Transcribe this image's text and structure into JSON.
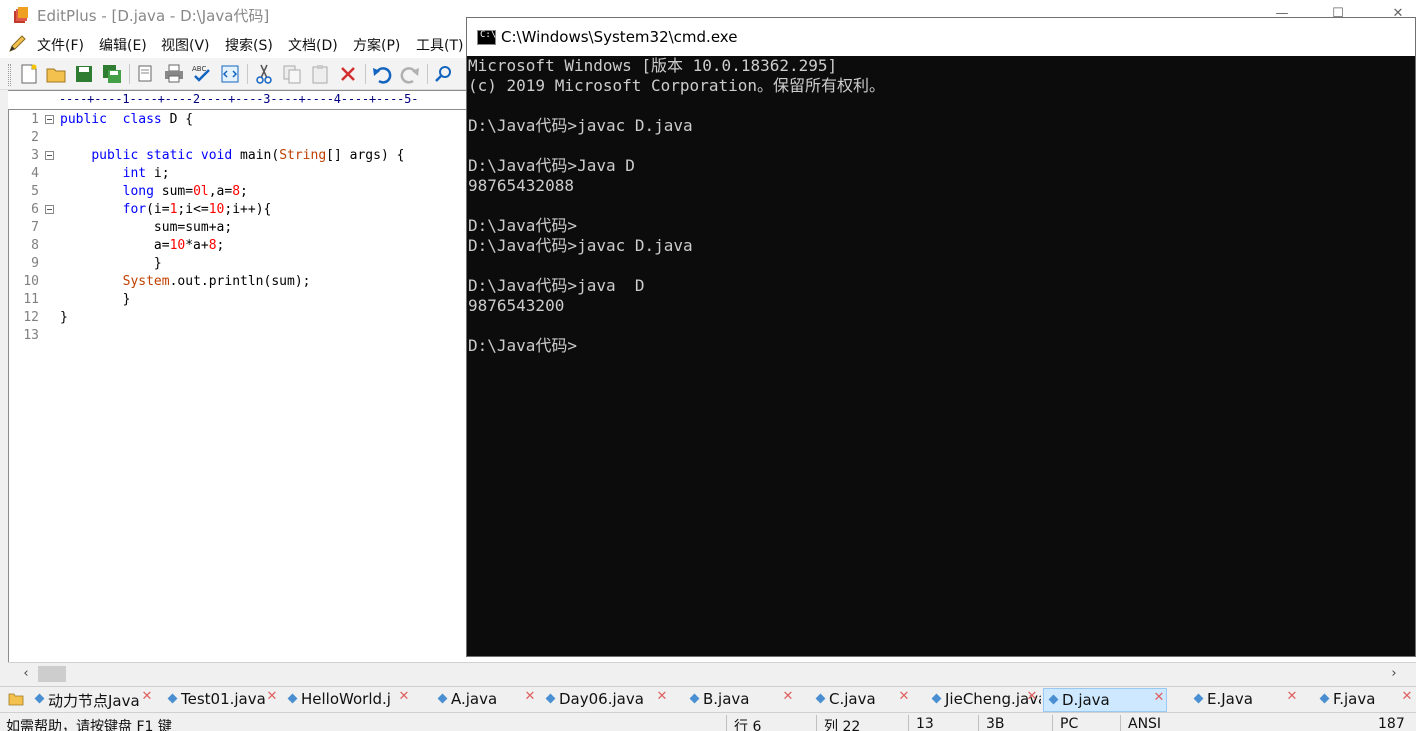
{
  "editplus": {
    "title": "EditPlus - [D.java - D:\\Java代码]",
    "window_controls": [
      "—",
      "☐",
      "✕"
    ],
    "menu": [
      "文件(F)",
      "编辑(E)",
      "视图(V)",
      "搜索(S)",
      "文档(D)",
      "方案(P)",
      "工具(T)"
    ],
    "toolbar": [
      "new-file",
      "open-file",
      "save",
      "save-all",
      "print-preview",
      "print",
      "spell-check",
      "html-preview",
      "cut",
      "copy",
      "paste",
      "delete",
      "undo",
      "redo",
      "find"
    ],
    "ruler": "----+----1----+----2----+----3----+----4----+----5-",
    "lines": [
      {
        "n": "1",
        "fold": true,
        "segs": [
          [
            "kw",
            "public"
          ],
          [
            "",
            "  "
          ],
          [
            "kw",
            "class"
          ],
          [
            "",
            " D {"
          ]
        ]
      },
      {
        "n": "2",
        "fold": false,
        "segs": []
      },
      {
        "n": "3",
        "fold": true,
        "segs": [
          [
            "",
            "    "
          ],
          [
            "kw",
            "public"
          ],
          [
            "",
            ""
          ],
          [
            "kw",
            " static"
          ],
          [
            "kw",
            " void"
          ],
          [
            "",
            " main("
          ],
          [
            "ty",
            "String"
          ],
          [
            "",
            "[] args) {"
          ]
        ]
      },
      {
        "n": "4",
        "fold": false,
        "segs": [
          [
            "",
            "        "
          ],
          [
            "kw",
            "int"
          ],
          [
            "",
            " i;"
          ]
        ]
      },
      {
        "n": "5",
        "fold": false,
        "segs": [
          [
            "",
            "        "
          ],
          [
            "kw",
            "long"
          ],
          [
            "",
            " sum="
          ],
          [
            "num",
            "0l"
          ],
          [
            "",
            ",a="
          ],
          [
            "num",
            "8"
          ],
          [
            "",
            ";"
          ]
        ]
      },
      {
        "n": "6",
        "fold": true,
        "segs": [
          [
            "",
            "        "
          ],
          [
            "kw",
            "for"
          ],
          [
            "",
            "(i="
          ],
          [
            "num",
            "1"
          ],
          [
            "",
            ";i<="
          ],
          [
            "num",
            "10"
          ],
          [
            "",
            ";i++){"
          ]
        ]
      },
      {
        "n": "7",
        "fold": false,
        "segs": [
          [
            "",
            "            sum=sum+a;"
          ]
        ]
      },
      {
        "n": "8",
        "fold": false,
        "segs": [
          [
            "",
            "            a="
          ],
          [
            "num",
            "10"
          ],
          [
            "",
            "*a+"
          ],
          [
            "num",
            "8"
          ],
          [
            "",
            ";"
          ]
        ]
      },
      {
        "n": "9",
        "fold": false,
        "segs": [
          [
            "",
            "            }"
          ]
        ]
      },
      {
        "n": "10",
        "fold": false,
        "segs": [
          [
            "",
            "        "
          ],
          [
            "ty",
            "System"
          ],
          [
            "",
            ".out.println(sum);"
          ]
        ]
      },
      {
        "n": "11",
        "fold": false,
        "segs": [
          [
            "",
            "        }"
          ]
        ]
      },
      {
        "n": "12",
        "fold": false,
        "segs": [
          [
            "",
            "}"
          ]
        ]
      },
      {
        "n": "13",
        "fold": false,
        "segs": []
      }
    ],
    "tabs": [
      {
        "label": "动力节点Java",
        "active": false
      },
      {
        "label": "Test01.java",
        "active": false
      },
      {
        "label": "HelloWorld.j",
        "active": false
      },
      {
        "label": "A.java",
        "active": false
      },
      {
        "label": "Day06.java",
        "active": false
      },
      {
        "label": "B.java",
        "active": false
      },
      {
        "label": "C.java",
        "active": false
      },
      {
        "label": "JieCheng.java",
        "active": false
      },
      {
        "label": "D.java",
        "active": true
      },
      {
        "label": "E.Java",
        "active": false
      },
      {
        "label": "F.java",
        "active": false
      }
    ],
    "status": {
      "help": "如需帮助，请按键盘 F1 键",
      "row": "行 6",
      "col": "列 22",
      "lines": "13",
      "size": "3B",
      "mode": "PC",
      "encoding": "ANSI",
      "extra": "187"
    }
  },
  "cmd": {
    "title": "C:\\Windows\\System32\\cmd.exe",
    "icon_text": "C:\\",
    "lines": [
      "Microsoft Windows [版本 10.0.18362.295]",
      "(c) 2019 Microsoft Corporation。保留所有权利。",
      "",
      "D:\\Java代码>javac D.java",
      "",
      "D:\\Java代码>Java D",
      "98765432088",
      "",
      "D:\\Java代码>",
      "D:\\Java代码>javac D.java",
      "",
      "D:\\Java代码>java  D",
      "9876543200",
      "",
      "D:\\Java代码>"
    ]
  },
  "colors": {
    "keyword": "#0000ff",
    "type": "#c04000",
    "number": "#ff0000",
    "console_bg": "#0c0c0c",
    "console_fg": "#cccccc"
  }
}
